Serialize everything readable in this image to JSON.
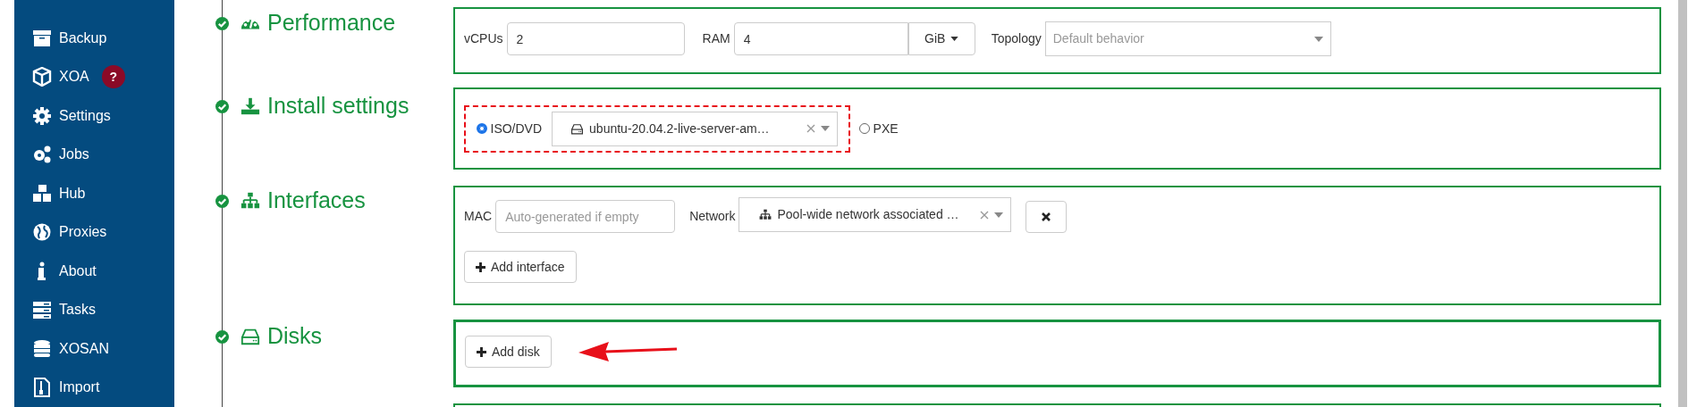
{
  "sidebar": {
    "items": [
      {
        "label": "Backup"
      },
      {
        "label": "XOA",
        "badge": "?"
      },
      {
        "label": "Settings"
      },
      {
        "label": "Jobs"
      },
      {
        "label": "Hub"
      },
      {
        "label": "Proxies"
      },
      {
        "label": "About"
      },
      {
        "label": "Tasks"
      },
      {
        "label": "XOSAN"
      },
      {
        "label": "Import"
      }
    ]
  },
  "sections": [
    {
      "kind": "performance",
      "title": "Performance",
      "valid": true,
      "vcpus": {
        "label": "vCPUs",
        "value": "2"
      },
      "ram": {
        "label": "RAM",
        "value": "4",
        "unit": "GiB"
      },
      "topology": {
        "label": "Topology",
        "placeholder": "Default behavior"
      }
    },
    {
      "kind": "install",
      "title": "Install settings",
      "valid": true,
      "options": [
        {
          "label": "ISO/DVD",
          "selected": true,
          "value": "ubuntu-20.04.2-live-server-am…",
          "highlighted": true
        },
        {
          "label": "PXE",
          "selected": false
        }
      ]
    },
    {
      "kind": "interfaces",
      "title": "Interfaces",
      "valid": true,
      "mac": {
        "label": "MAC",
        "placeholder": "Auto-generated if empty"
      },
      "network": {
        "label": "Network",
        "value": "Pool-wide network associated …"
      },
      "add_button": "Add interface"
    },
    {
      "kind": "disks",
      "title": "Disks",
      "valid": true,
      "active": true,
      "add_button": "Add disk",
      "pointer_arrow": true
    }
  ]
}
